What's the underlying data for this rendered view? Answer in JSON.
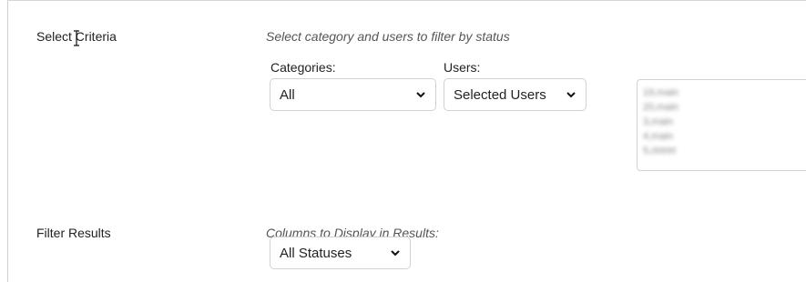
{
  "select_criteria": {
    "label": "Select Criteria",
    "hint": "Select category and users to filter by status",
    "categories": {
      "label": "Categories:",
      "selected": "All"
    },
    "users": {
      "label": "Users:",
      "selected": "Selected Users",
      "list_items": [
        "19,main",
        "20,main",
        "3,main",
        "4,main",
        "5,rtrtrtrt"
      ]
    }
  },
  "filter_results": {
    "label": "Filter Results",
    "hint": "Columns to Display in Results:",
    "status": {
      "selected": "All Statuses"
    }
  },
  "icons": {
    "dropdown": "chevron-down-icon",
    "cursor": "text-cursor-icon"
  }
}
